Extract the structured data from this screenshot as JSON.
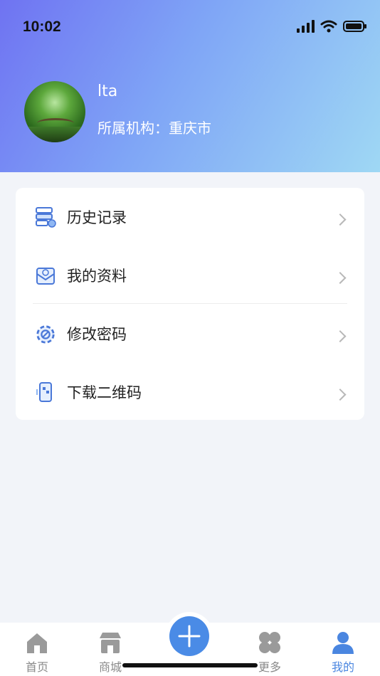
{
  "status_bar": {
    "time": "10:02"
  },
  "profile": {
    "username": "lta",
    "org_label": "所属机构：",
    "org_value": "重庆市"
  },
  "menu": {
    "items": [
      {
        "label": "历史记录",
        "icon": "history-records-icon"
      },
      {
        "label": "我的资料",
        "icon": "profile-mail-icon"
      },
      {
        "label": "修改密码",
        "icon": "settings-gear-icon"
      },
      {
        "label": "下载二维码",
        "icon": "qrcode-download-icon"
      }
    ]
  },
  "tabbar": {
    "items": [
      {
        "label": "首页",
        "icon": "home-icon"
      },
      {
        "label": "商城",
        "icon": "shop-icon"
      },
      {
        "label": "更多",
        "icon": "clover-icon"
      },
      {
        "label": "我的",
        "icon": "user-icon",
        "active": true
      }
    ],
    "fab_icon": "plus-icon"
  },
  "colors": {
    "accent": "#4a86e0",
    "header_gradient_start": "#6f73f2",
    "header_gradient_end": "#9fd8f4",
    "inactive_tab": "#8a8a8a"
  }
}
